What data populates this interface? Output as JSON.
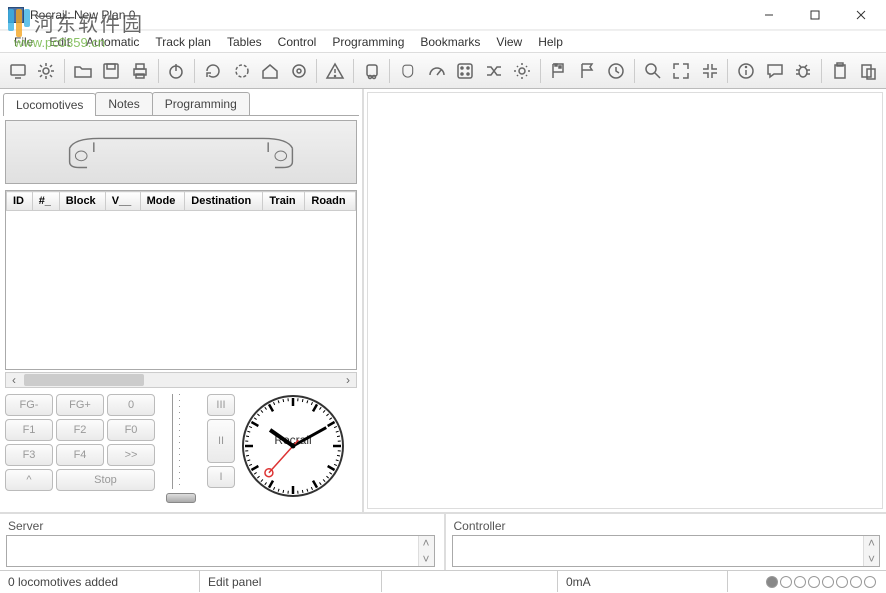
{
  "window": {
    "title": "Rocrail: New Plan 0"
  },
  "watermark": {
    "text": "河东软件园",
    "url": "www.pc0359.cn"
  },
  "menu": {
    "file": "File",
    "edit": "Edit",
    "automatic": "Automatic",
    "trackplan": "Track plan",
    "tables": "Tables",
    "control": "Control",
    "programming": "Programming",
    "bookmarks": "Bookmarks",
    "view": "View",
    "help": "Help"
  },
  "toolbar_icons": [
    "monitor-icon",
    "gear-icon",
    "sep",
    "folder-open-icon",
    "save-icon",
    "print-icon",
    "sep",
    "power-icon",
    "sep",
    "refresh-icon",
    "refresh-dashed-icon",
    "home-icon",
    "target-icon",
    "sep",
    "warning-icon",
    "sep",
    "train-icon",
    "sep",
    "mouse-icon",
    "gauge-icon",
    "random-icon",
    "shuffle-icon",
    "light-icon",
    "sep",
    "flag-checkered-icon",
    "flag-icon",
    "clock-icon",
    "sep",
    "zoom-icon",
    "expand-icon",
    "shrink-icon",
    "sep",
    "info-icon",
    "chat-icon",
    "bug-icon",
    "sep",
    "clipboard-icon",
    "paste-icon"
  ],
  "tabs": {
    "locomotives": "Locomotives",
    "notes": "Notes",
    "programming": "Programming"
  },
  "table": {
    "cols": [
      "ID",
      "#_",
      "Block",
      "V__",
      "Mode",
      "Destination",
      "Train",
      "Roadn"
    ]
  },
  "fnpad": {
    "fgminus": "FG-",
    "fgplus": "FG+",
    "zero": "0",
    "f1": "F1",
    "f2": "F2",
    "f0": "F0",
    "f3": "F3",
    "f4": "F4",
    "fwd": ">>",
    "caret": "^",
    "stop": "Stop",
    "r3": "III",
    "r2": "II",
    "r1": "I"
  },
  "clock": {
    "brand": "Rocrail",
    "hour": 10,
    "minute": 10,
    "second": 37
  },
  "bottom": {
    "server": "Server",
    "controller": "Controller"
  },
  "status": {
    "locos": "0 locomotives added",
    "mode": "Edit panel",
    "blank": "",
    "current": "0mA"
  }
}
